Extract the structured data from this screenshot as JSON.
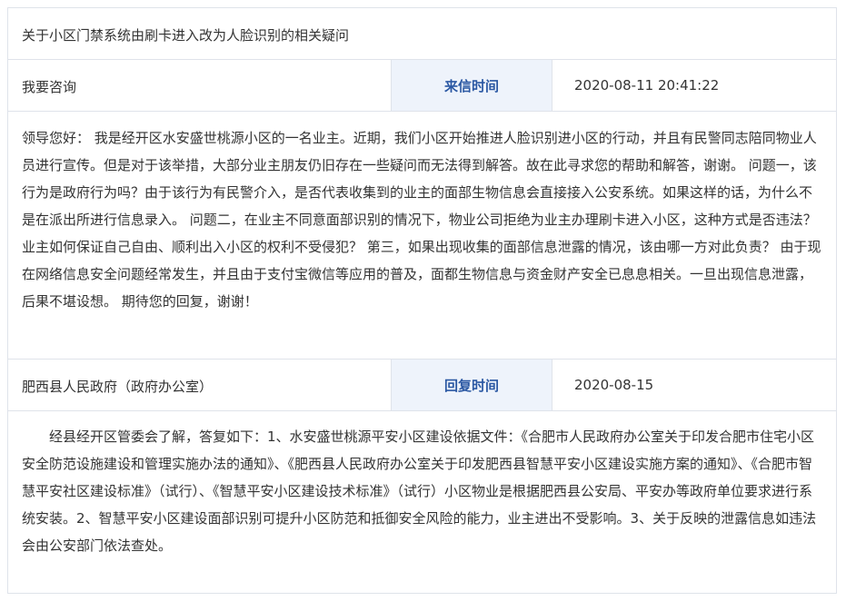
{
  "inquiry": {
    "title": "关于小区门禁系统由刷卡进入改为人脸识别的相关疑问",
    "type": "我要咨询",
    "date_label": "来信时间",
    "date": "2020-08-11 20:41:22",
    "content": "领导您好： 我是经开区水安盛世桃源小区的一名业主。近期，我们小区开始推进人脸识别进小区的行动，并且有民警同志陪同物业人员进行宣传。但是对于该举措，大部分业主朋友仍旧存在一些疑问而无法得到解答。故在此寻求您的帮助和解答，谢谢。 问题一，该行为是政府行为吗？由于该行为有民警介入，是否代表收集到的业主的面部生物信息会直接接入公安系统。如果这样的话，为什么不是在派出所进行信息录入。 问题二，在业主不同意面部识别的情况下，物业公司拒绝为业主办理刷卡进入小区，这种方式是否违法？业主如何保证自己自由、顺利出入小区的权利不受侵犯？ 第三，如果出现收集的面部信息泄露的情况，该由哪一方对此负责？ 由于现在网络信息安全问题经常发生，并且由于支付宝微信等应用的普及，面都生物信息与资金财产安全已息息相关。一旦出现信息泄露，后果不堪设想。 期待您的回复，谢谢！"
  },
  "reply": {
    "department": "肥西县人民政府（政府办公室）",
    "date_label": "回复时间",
    "date": "2020-08-15",
    "content": "经县经开区管委会了解，答复如下：1、水安盛世桃源平安小区建设依据文件：《合肥市人民政府办公室关于印发合肥市住宅小区安全防范设施建设和管理实施办法的通知》、《肥西县人民政府办公室关于印发肥西县智慧平安小区建设实施方案的通知》、《合肥市智慧平安社区建设标准》（试行）、《智慧平安小区建设技术标准》（试行）小区物业是根据肥西县公安局、平安办等政府单位要求进行系统安装。2、智慧平安小区建设面部识别可提升小区防范和抵御安全风险的能力，业主进出不受影响。3、关于反映的泄露信息如违法会由公安部门依法查处。"
  }
}
